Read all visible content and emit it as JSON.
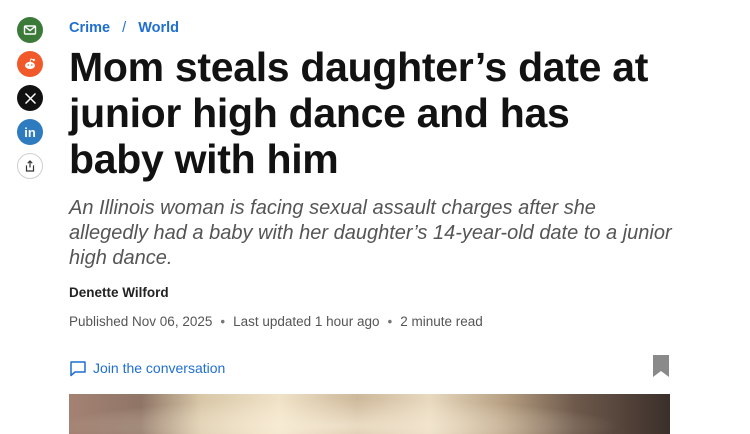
{
  "share": {
    "items": [
      {
        "name": "email",
        "icon": "envelope-icon"
      },
      {
        "name": "reddit",
        "icon": "reddit-icon"
      },
      {
        "name": "x",
        "icon": "x-icon"
      },
      {
        "name": "linkedin",
        "icon": "linkedin-icon",
        "text": "in"
      },
      {
        "name": "more",
        "icon": "share-icon"
      }
    ]
  },
  "breadcrumb": {
    "items": [
      "Crime",
      "World"
    ],
    "separator": "/"
  },
  "headline": "Mom steals daughter’s date at junior high dance and has baby with him",
  "dek": "An Illinois woman is facing sexual assault charges after she allegedly had a baby with her daughter’s 14-year-old date to a junior high dance.",
  "author": "Denette Wilford",
  "meta": {
    "published": "Published Nov 06, 2025",
    "updated": "Last updated 1 hour ago",
    "read_time": "2 minute read",
    "separator": "•"
  },
  "toolbar": {
    "join_label": "Join the conversation",
    "bookmark_icon": "bookmark-icon"
  },
  "colors": {
    "link": "#1f6fd1",
    "email": "#3c7a3a",
    "reddit": "#f1592a",
    "x": "#111111",
    "linkedin": "#2e7bbf"
  }
}
